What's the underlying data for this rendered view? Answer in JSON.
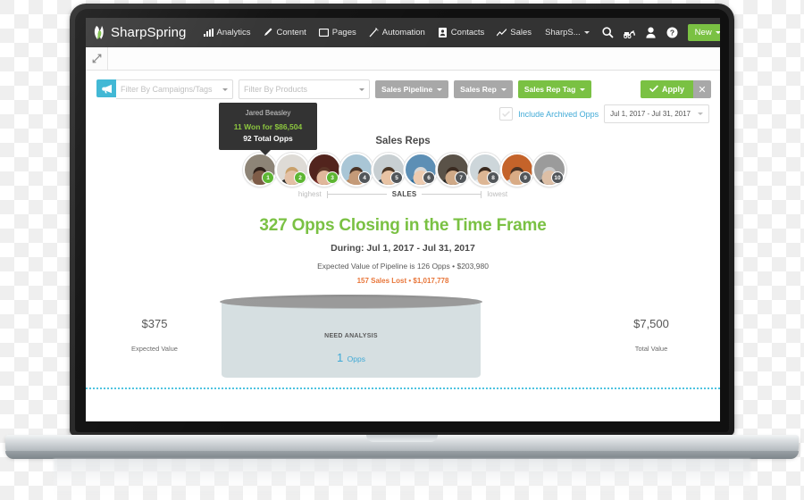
{
  "app": {
    "brand": "SharpSpring",
    "nav_items": [
      {
        "label": "Analytics",
        "icon": "bar-chart-icon"
      },
      {
        "label": "Content",
        "icon": "pencil-icon"
      },
      {
        "label": "Pages",
        "icon": "window-icon"
      },
      {
        "label": "Automation",
        "icon": "wand-icon"
      },
      {
        "label": "Contacts",
        "icon": "contact-card-icon"
      },
      {
        "label": "Sales",
        "icon": "trend-line-icon"
      }
    ],
    "account_label": "SharpS...",
    "right_icons": [
      "search-icon",
      "carriage-icon",
      "person-icon",
      "help-icon"
    ],
    "new_button": "New",
    "avatar_icon": "pin-icon",
    "expand_icon": "expand-icon"
  },
  "filters": {
    "megaphone_icon": "megaphone-icon",
    "campaign_placeholder": "Filter By Campaigns/Tags",
    "product_placeholder": "Filter By Products",
    "pipeline_button": "Sales Pipeline",
    "rep_button": "Sales Rep",
    "rep_tag_button": "Sales Rep Tag",
    "apply_button": "Apply",
    "clear_button": "✕",
    "archived_label": "Include Archived Opps",
    "archived_checked": false,
    "date_range": "Jul 1, 2017 - Jul 31, 2017"
  },
  "tooltip": {
    "name": "Jared Beasley",
    "won": "11 Won for $86,504",
    "total": "92 Total Opps"
  },
  "reps": {
    "title": "Sales Reps",
    "scale_high": "highest",
    "scale_mid": "SALES",
    "scale_low": "lowest",
    "list": [
      {
        "rank": "1",
        "top": true,
        "skin": "#7c5a45",
        "hair": "#2b1d16",
        "shirt": "#cfc6b8",
        "bg": "#8c8375"
      },
      {
        "rank": "2",
        "top": true,
        "skin": "#e3c0a4",
        "hair": "#c9a06a",
        "shirt": "#2e2e2e",
        "bg": "#dedbd6"
      },
      {
        "rank": "3",
        "top": true,
        "skin": "#e0b79a",
        "hair": "#5a3426",
        "shirt": "#7c2f2a",
        "bg": "#51231c"
      },
      {
        "rank": "4",
        "top": false,
        "skin": "#c49a78",
        "hair": "#4a3326",
        "shirt": "#b98b63",
        "bg": "#a9c6d6"
      },
      {
        "rank": "5",
        "top": false,
        "skin": "#e8c3a4",
        "hair": "#4b3726",
        "shirt": "#3b4a55",
        "bg": "#c8cfd2"
      },
      {
        "rank": "6",
        "top": false,
        "skin": "#edcbb0",
        "hair": "#d8d8d8",
        "shirt": "#2f6f9e",
        "bg": "#5d8fb5"
      },
      {
        "rank": "7",
        "top": false,
        "skin": "#cfa987",
        "hair": "#3a2a20",
        "shirt": "#2a2a2a",
        "bg": "#5a5248"
      },
      {
        "rank": "8",
        "top": false,
        "skin": "#ddb694",
        "hair": "#3b2b20",
        "shirt": "#e8ecef",
        "bg": "#cdd6da"
      },
      {
        "rank": "9",
        "top": false,
        "skin": "#d9ab85",
        "hair": "#4a3325",
        "shirt": "#d8e2e8",
        "bg": "#c4632a"
      },
      {
        "rank": "10",
        "top": false,
        "skin": "#ddbfa6",
        "hair": "#c8c8c8",
        "shirt": "#4a4a4a",
        "bg": "#9b9b9b"
      }
    ]
  },
  "summary": {
    "headline": "327 Opps Closing in the Time Frame",
    "during": "During: Jul 1, 2017 - Jul 31, 2017",
    "expected": "Expected Value of Pipeline is 126 Opps • $203,980",
    "lost": "157 Sales Lost • $1,017,778"
  },
  "funnel": {
    "left_amount": "$375",
    "left_label": "Expected Value",
    "right_amount": "$7,500",
    "right_label": "Total Value",
    "stage_name": "NEED ANALYSIS",
    "stage_count": "1",
    "stage_unit": "Opps"
  },
  "colors": {
    "brand_green": "#7ac143",
    "navbar": "#333333",
    "accent_blue": "#3fa9d6",
    "lost_orange": "#e8763a",
    "teal": "#34b3d2"
  }
}
